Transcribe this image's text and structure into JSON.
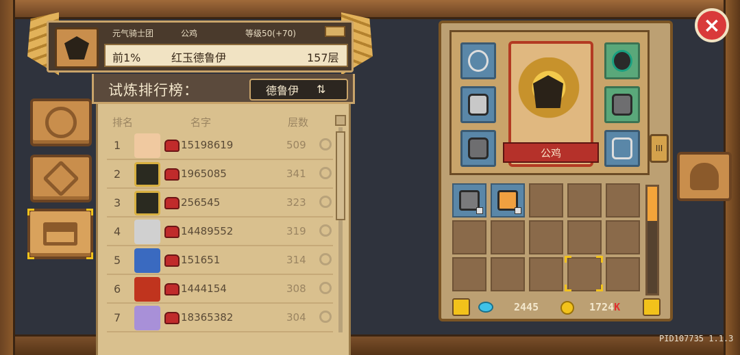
{
  "header": {
    "guild": "元气骑士团",
    "player_name": "公鸡",
    "level": "等级50(+70)",
    "rank_percent": "前1%",
    "hero_name": "红玉德鲁伊",
    "floors": "157层"
  },
  "leaderboard": {
    "title": "试炼排行榜：",
    "hero_filter": "德鲁伊",
    "columns": [
      "排名",
      "名字",
      "层数"
    ],
    "rows": [
      {
        "rank": "1",
        "uid": "15198619",
        "floors": "509"
      },
      {
        "rank": "2",
        "uid": "1965085",
        "floors": "341"
      },
      {
        "rank": "3",
        "uid": "256545",
        "floors": "323"
      },
      {
        "rank": "4",
        "uid": "14489552",
        "floors": "319"
      },
      {
        "rank": "5",
        "uid": "151651",
        "floors": "314"
      },
      {
        "rank": "6",
        "uid": "1444154",
        "floors": "308"
      },
      {
        "rank": "7",
        "uid": "18365382",
        "floors": "304"
      }
    ]
  },
  "character": {
    "name": "公鸡",
    "side_knob": "III"
  },
  "currency": {
    "gems": "2445",
    "coins": "1724",
    "coins_suffix": "K"
  },
  "footer": {
    "pid": "PID107735 1.1.3"
  },
  "icons": {
    "close": "×",
    "swap": "⇅"
  }
}
